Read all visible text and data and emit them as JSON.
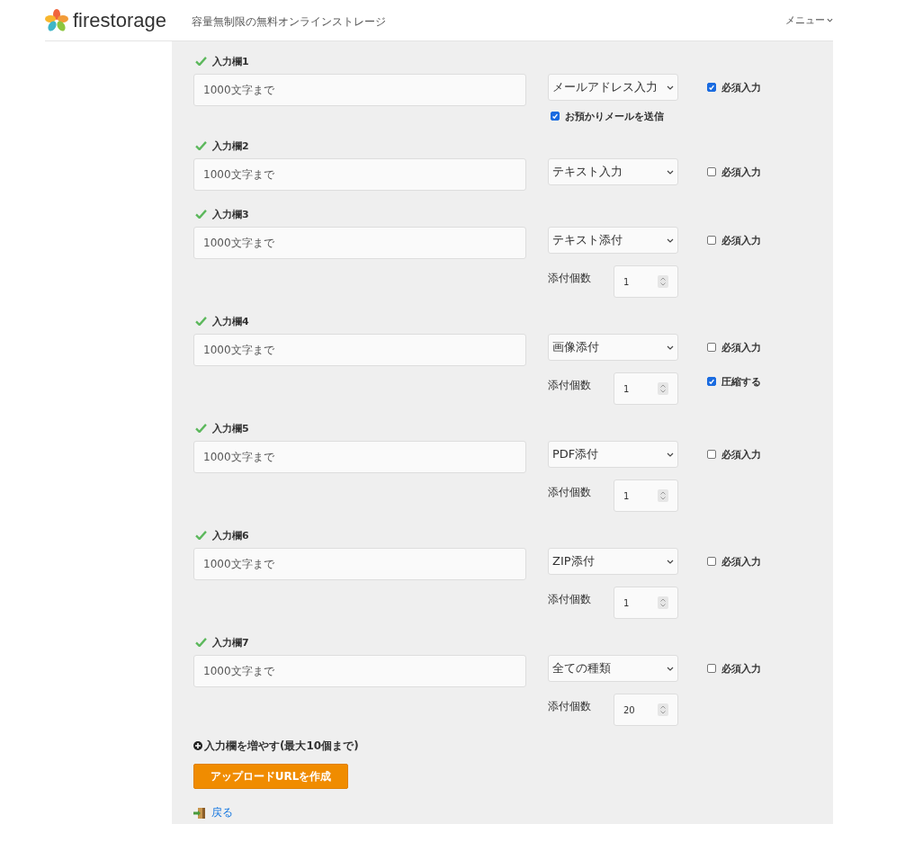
{
  "header": {
    "logo": "firestorage",
    "tagline": "容量無制限の無料オンラインストレージ",
    "menu": "メニュー"
  },
  "fields": [
    {
      "label": "入力欄1",
      "placeholder": "1000文字まで",
      "type": "メールアドレス入力",
      "required": {
        "label": "必須入力",
        "checked": true
      },
      "mail_notice": {
        "label": "お預かりメールを送信",
        "checked": true
      }
    },
    {
      "label": "入力欄2",
      "placeholder": "1000文字まで",
      "type": "テキスト入力",
      "required": {
        "label": "必須入力",
        "checked": false
      }
    },
    {
      "label": "入力欄3",
      "placeholder": "1000文字まで",
      "type": "テキスト添付",
      "required": {
        "label": "必須入力",
        "checked": false
      },
      "count": {
        "label": "添付個数",
        "value": "1"
      }
    },
    {
      "label": "入力欄4",
      "placeholder": "1000文字まで",
      "type": "画像添付",
      "required": {
        "label": "必須入力",
        "checked": false
      },
      "count": {
        "label": "添付個数",
        "value": "1"
      },
      "compress": {
        "label": "圧縮する",
        "checked": true
      }
    },
    {
      "label": "入力欄5",
      "placeholder": "1000文字まで",
      "type": "PDF添付",
      "required": {
        "label": "必須入力",
        "checked": false
      },
      "count": {
        "label": "添付個数",
        "value": "1"
      }
    },
    {
      "label": "入力欄6",
      "placeholder": "1000文字まで",
      "type": "ZIP添付",
      "required": {
        "label": "必須入力",
        "checked": false
      },
      "count": {
        "label": "添付個数",
        "value": "1"
      }
    },
    {
      "label": "入力欄7",
      "placeholder": "1000文字まで",
      "type": "全ての種類",
      "required": {
        "label": "必須入力",
        "checked": false
      },
      "count": {
        "label": "添付個数",
        "value": "20"
      }
    }
  ],
  "add_field": "入力欄を増やす(最大10個まで)",
  "create_button": "アップロードURLを作成",
  "back_link": "戻る"
}
